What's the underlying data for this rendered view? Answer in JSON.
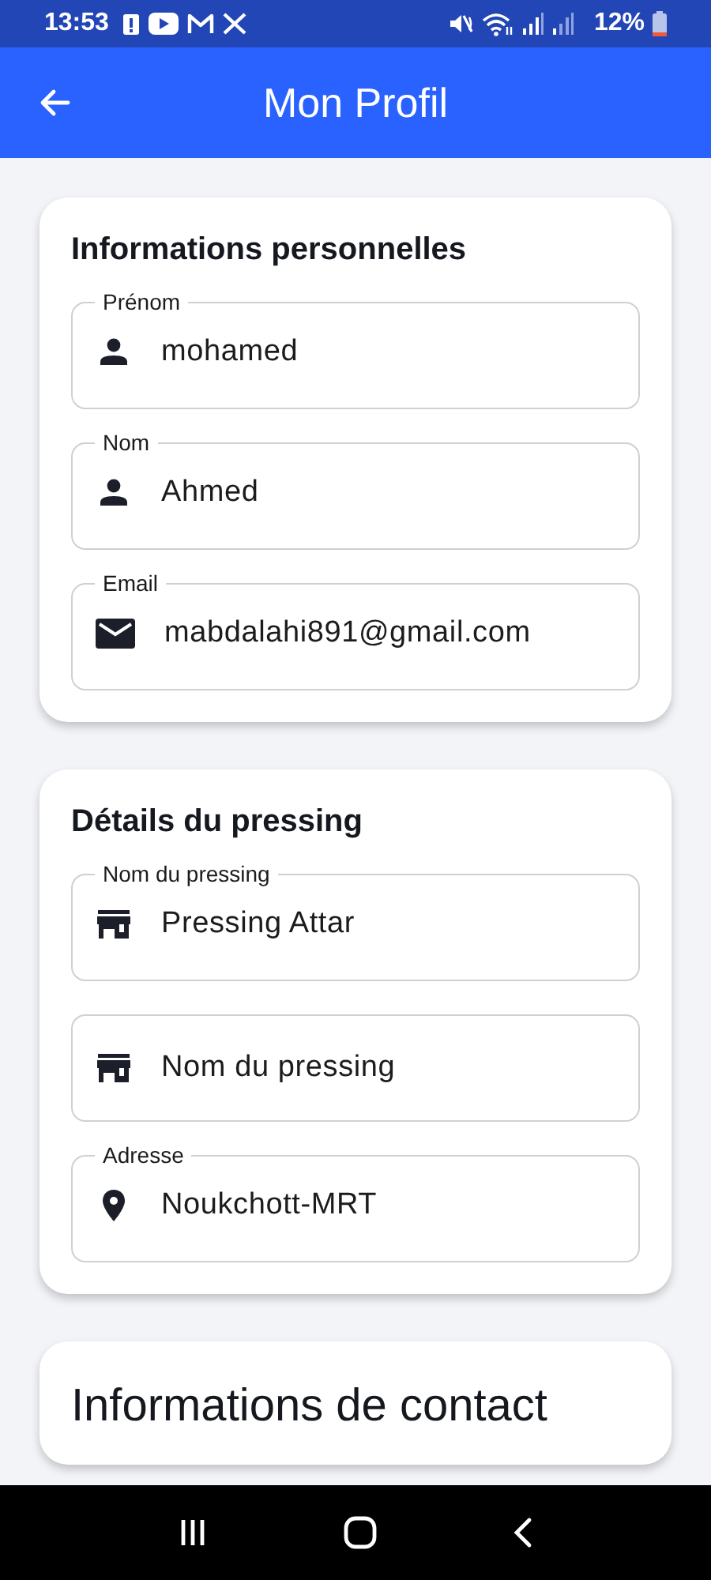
{
  "status_bar": {
    "time": "13:53",
    "battery_percent": "12%"
  },
  "app_bar": {
    "title": "Mon Profil"
  },
  "sections": [
    {
      "title": "Informations personnelles",
      "fields": [
        {
          "kind": "person",
          "label": "Prénom",
          "value": "mohamed"
        },
        {
          "kind": "person",
          "label": "Nom",
          "value": "Ahmed"
        },
        {
          "kind": "mail",
          "label": "Email",
          "value": "mabdalahi891@gmail.com"
        }
      ]
    },
    {
      "title": "Détails du pressing",
      "fields": [
        {
          "kind": "store",
          "label": "Nom du pressing",
          "value": "Pressing Attar"
        },
        {
          "kind": "store",
          "placeholder": "Nom du pressing"
        },
        {
          "kind": "pin",
          "label": "Adresse",
          "value": "Noukchott-MRT"
        }
      ]
    },
    {
      "title": "Informations de contact"
    }
  ]
}
